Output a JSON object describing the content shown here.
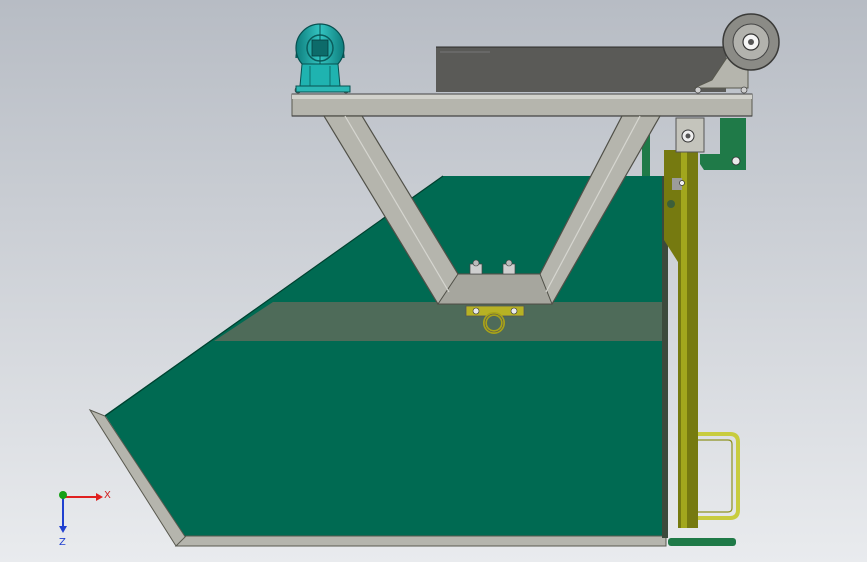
{
  "colors": {
    "background_top": "#b7bcc4",
    "background_bottom": "#e9ebee",
    "hopper_green": "#006a52",
    "hopper_edge": "#00402f",
    "frame_steel": "#b5b5ad",
    "frame_dark": "#59594f",
    "tray_dark": "#5a5a57",
    "rail_olive": "#767a10",
    "rail_olive_light": "#a2a71d",
    "handle_yellow": "#c8cc3e",
    "caster_teal": "#1aa7a5",
    "pipe_green": "#1f7a48",
    "axis_x": "#e02020",
    "axis_y": "#16a016",
    "axis_z": "#2040d0"
  },
  "icons": {
    "caster_wheel": "caster-wheel-icon",
    "roller_wheel": "roller-wheel-icon",
    "eye_bolt": "eye-bolt-icon",
    "triad": "coordinate-triad-icon"
  },
  "axis_triad": {
    "x_label": "X",
    "z_label": "Z"
  }
}
